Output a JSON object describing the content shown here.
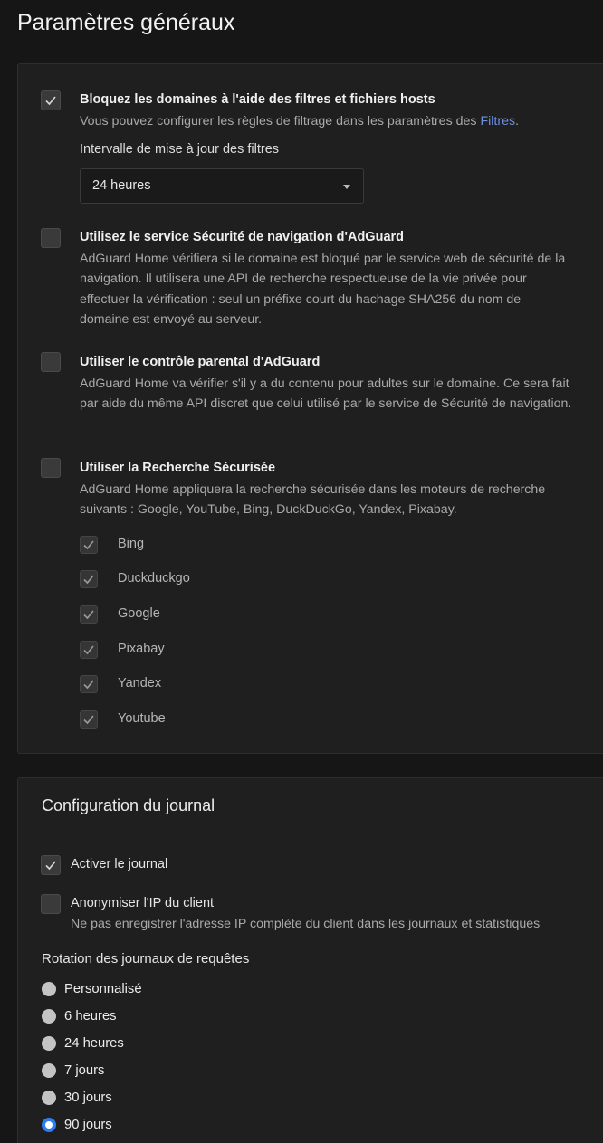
{
  "page_title": "Paramètres généraux",
  "filters": {
    "block": {
      "title": "Bloquez les domaines à l'aide des filtres et fichiers hosts",
      "desc_prefix": "Vous pouvez configurer les règles de filtrage dans les paramètres des ",
      "desc_link": "Filtres",
      "desc_suffix": ".",
      "checked": true
    },
    "interval": {
      "label": "Intervalle de mise à jour des filtres",
      "value": "24 heures"
    },
    "safebrowsing": {
      "title": "Utilisez le service Sécurité de navigation d'AdGuard",
      "desc": "AdGuard Home vérifiera si le domaine est bloqué par le service web de sécurité de la navigation. Il utilisera une API de recherche respectueuse de la vie privée pour effectuer la vérification : seul un préfixe court du hachage SHA256 du nom de domaine est envoyé au serveur.",
      "checked": false
    },
    "parental": {
      "title": "Utiliser le contrôle parental d'AdGuard",
      "desc": "AdGuard Home va vérifier s'il y a du contenu pour adultes sur le domaine. Ce sera fait par aide du même API discret que celui utilisé par le service de Sécurité de navigation.",
      "checked": false
    },
    "safesearch": {
      "title": "Utiliser la Recherche Sécurisée",
      "desc": "AdGuard Home appliquera la recherche sécurisée dans les moteurs de recherche suivants : Google, YouTube, Bing, DuckDuckGo, Yandex, Pixabay.",
      "checked": false,
      "engines": [
        "Bing",
        "Duckduckgo",
        "Google",
        "Pixabay",
        "Yandex",
        "Youtube"
      ]
    }
  },
  "log": {
    "title": "Configuration du journal",
    "enable": {
      "label": "Activer le journal",
      "checked": true
    },
    "anonymize": {
      "label": "Anonymiser l'IP du client",
      "desc": "Ne pas enregistrer l'adresse IP complète du client dans les journaux et statistiques",
      "checked": false
    },
    "rotation": {
      "label": "Rotation des journaux de requêtes",
      "options": [
        "Personnalisé",
        "6 heures",
        "24 heures",
        "7 jours",
        "30 jours",
        "90 jours"
      ],
      "selected": "90 jours"
    }
  },
  "colors": {
    "accent": "#2f7cf0",
    "link": "#6f8fe0",
    "background": "#161616",
    "card": "#1f1f1f"
  }
}
